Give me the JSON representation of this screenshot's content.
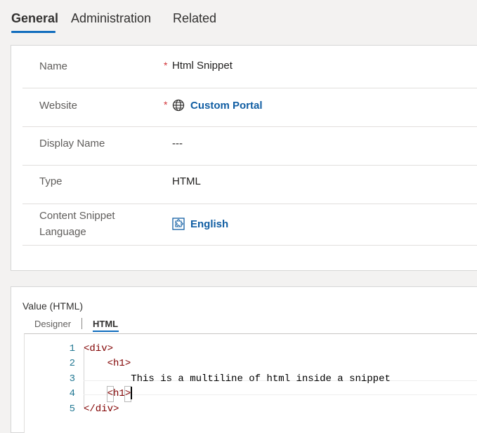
{
  "tabs": [
    {
      "label": "General"
    },
    {
      "label": "Administration"
    },
    {
      "label": "Related"
    }
  ],
  "general": {
    "name": {
      "label": "Name",
      "required": "*",
      "value": "Html Snippet"
    },
    "website": {
      "label": "Website",
      "required": "*",
      "value": "Custom Portal",
      "icon": "globe-icon"
    },
    "display_name": {
      "label": "Display Name",
      "value": "---"
    },
    "type": {
      "label": "Type",
      "value": "HTML"
    },
    "content_language": {
      "label_line1": "Content Snippet",
      "label_line2": "Language",
      "value": "English",
      "icon": "language-puzzle-icon"
    }
  },
  "value_field": {
    "label": "Value (HTML)",
    "subtabs": {
      "designer": "Designer",
      "html": "HTML"
    },
    "code": {
      "line_numbers": [
        "1",
        "2",
        "3",
        "4",
        "5"
      ],
      "line1": "<div>",
      "line2": "<h1>",
      "line3": "This is a multiline of html inside a snippet",
      "line4_open": "<",
      "line4_tag": "h1",
      "line4_close": ">",
      "line5": "</div>"
    }
  },
  "colors": {
    "accent": "#0f6cbd",
    "link": "#115ea3",
    "required": "#d13438",
    "tag": "#800000",
    "line_number": "#237893"
  }
}
